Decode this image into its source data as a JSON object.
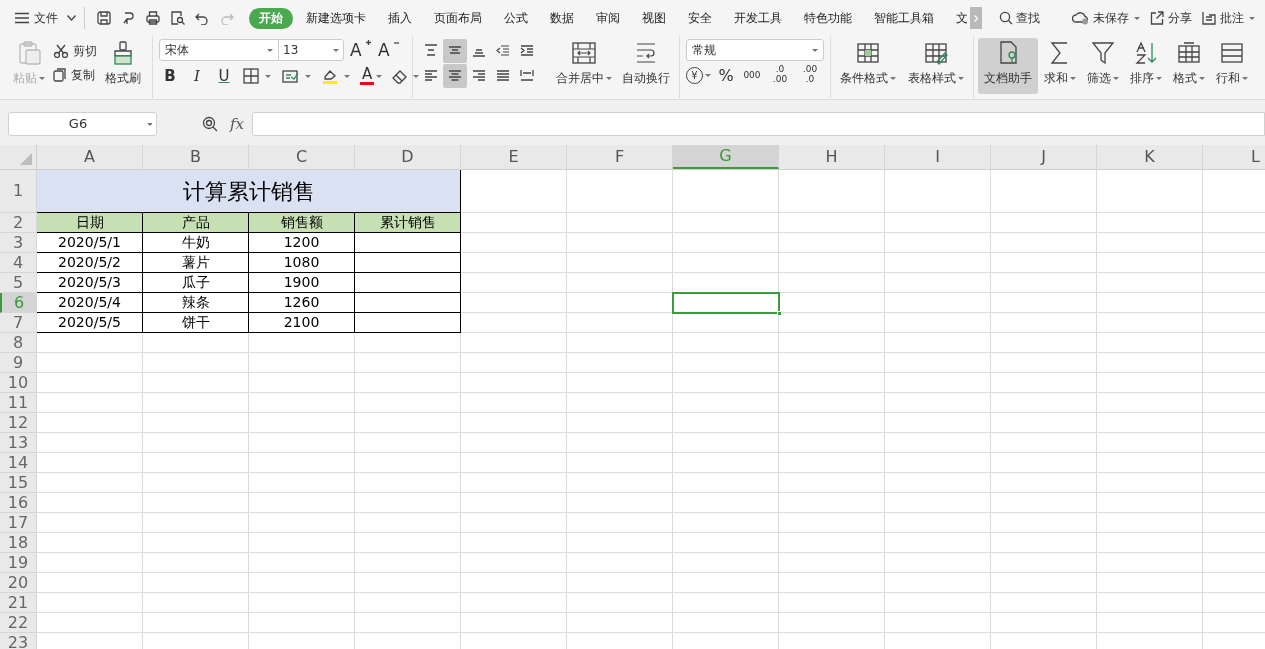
{
  "menu": {
    "label": "文件"
  },
  "tabs": [
    {
      "label": "开始",
      "selected": true
    },
    {
      "label": "新建选项卡",
      "selected": false
    },
    {
      "label": "插入",
      "selected": false
    },
    {
      "label": "页面布局",
      "selected": false
    },
    {
      "label": "公式",
      "selected": false
    },
    {
      "label": "数据",
      "selected": false
    },
    {
      "label": "审阅",
      "selected": false
    },
    {
      "label": "视图",
      "selected": false
    },
    {
      "label": "安全",
      "selected": false
    },
    {
      "label": "开发工具",
      "selected": false
    },
    {
      "label": "特色功能",
      "selected": false
    },
    {
      "label": "智能工具箱",
      "selected": false
    },
    {
      "label": "文",
      "selected": false
    }
  ],
  "actions": [
    {
      "label": "查找"
    },
    {
      "label": "未保存"
    },
    {
      "label": "分享"
    },
    {
      "label": "批注"
    }
  ],
  "clipboard": {
    "paste": {
      "label": "粘贴",
      "disabled": true
    },
    "cut": "剪切",
    "copy": "复制",
    "format_painter": "格式刷"
  },
  "font": {
    "family": "宋体",
    "size": "13",
    "grow": "A",
    "shrink": "A",
    "bold": "B",
    "italic": "I",
    "underline": "U",
    "font_color": "A"
  },
  "alignment": {
    "buttons": [
      {
        "selected": false
      },
      {
        "selected": true
      },
      {
        "selected": false
      },
      {
        "selected": false
      },
      {
        "selected": false
      },
      {
        "selected": false
      },
      {
        "selected": true
      },
      {
        "selected": false
      },
      {
        "selected": false
      },
      {
        "selected": false
      }
    ],
    "merge": "合并居中",
    "wrap": "自动换行"
  },
  "number": {
    "format": "常规",
    "currency": "¥",
    "percent": "%",
    "thousands": "000",
    "increase_decimal": [
      ".0",
      ".00"
    ],
    "decrease_decimal": [
      ".00",
      ".0"
    ]
  },
  "styles": [
    {
      "label": "条件格式"
    },
    {
      "label": "表格样式"
    }
  ],
  "tools": [
    {
      "label": "文档助手",
      "selected": true
    },
    {
      "label": "求和",
      "selected": false
    },
    {
      "label": "筛选",
      "selected": false
    },
    {
      "label": "排序",
      "selected": false
    },
    {
      "label": "格式",
      "selected": false
    },
    {
      "label": "行和",
      "selected": false
    }
  ],
  "formula_bar": {
    "name_box": "G6",
    "fx": "fx"
  },
  "sheet": {
    "columns": [
      {
        "label": "A",
        "selected": false
      },
      {
        "label": "B",
        "selected": false
      },
      {
        "label": "C",
        "selected": false
      },
      {
        "label": "D",
        "selected": false
      },
      {
        "label": "E",
        "selected": false
      },
      {
        "label": "F",
        "selected": false
      },
      {
        "label": "G",
        "selected": true
      },
      {
        "label": "H",
        "selected": false
      },
      {
        "label": "I",
        "selected": false
      },
      {
        "label": "J",
        "selected": false
      },
      {
        "label": "K",
        "selected": false
      },
      {
        "label": "L",
        "selected": false
      }
    ],
    "rows": [
      {
        "label": "1",
        "selected": false
      },
      {
        "label": "2",
        "selected": false
      },
      {
        "label": "3",
        "selected": false
      },
      {
        "label": "4",
        "selected": false
      },
      {
        "label": "5",
        "selected": false
      },
      {
        "label": "6",
        "selected": true
      },
      {
        "label": "7",
        "selected": false
      },
      {
        "label": "8",
        "selected": false
      },
      {
        "label": "9",
        "selected": false
      },
      {
        "label": "10",
        "selected": false
      },
      {
        "label": "11",
        "selected": false
      },
      {
        "label": "12",
        "selected": false
      },
      {
        "label": "13",
        "selected": false
      },
      {
        "label": "14",
        "selected": false
      },
      {
        "label": "15",
        "selected": false
      },
      {
        "label": "16",
        "selected": false
      },
      {
        "label": "17",
        "selected": false
      },
      {
        "label": "18",
        "selected": false
      },
      {
        "label": "19",
        "selected": false
      },
      {
        "label": "20",
        "selected": false
      },
      {
        "label": "21",
        "selected": false
      },
      {
        "label": "22",
        "selected": false
      },
      {
        "label": "23",
        "selected": false
      }
    ],
    "title": "计算累计销售",
    "header": [
      "日期",
      "产品",
      "销售额",
      "累计销售"
    ],
    "data": [
      [
        "2020/5/1",
        "牛奶",
        "1200"
      ],
      [
        "2020/5/2",
        "薯片",
        "1080"
      ],
      [
        "2020/5/3",
        "瓜子",
        "1900"
      ],
      [
        "2020/5/4",
        "辣条",
        "1260"
      ],
      [
        "2020/5/5",
        "饼干",
        "2100"
      ]
    ]
  }
}
